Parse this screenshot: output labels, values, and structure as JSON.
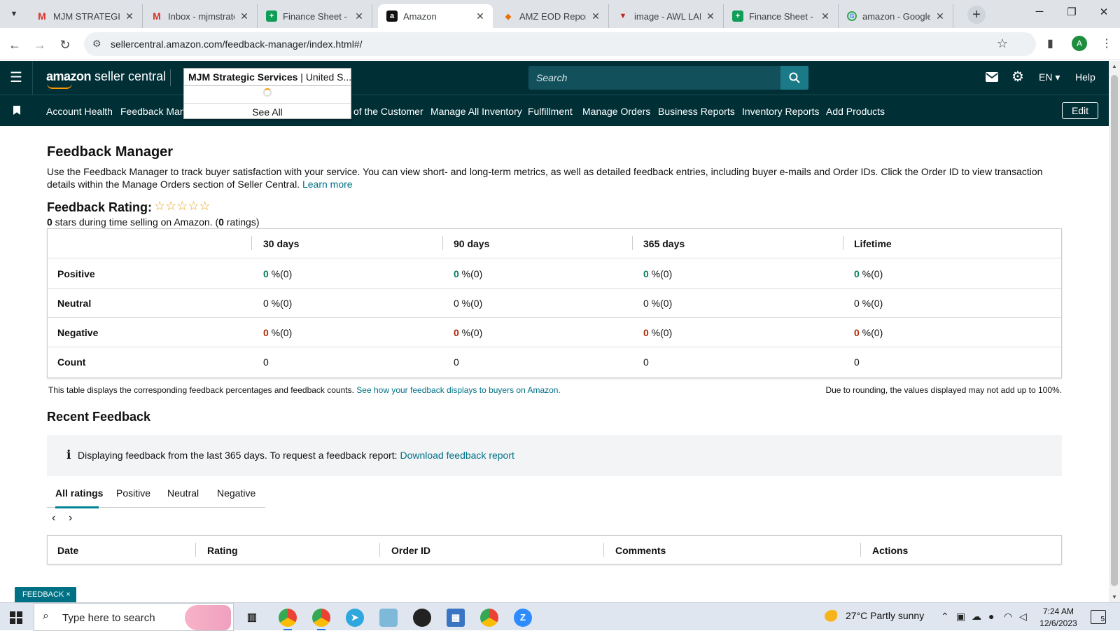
{
  "browser": {
    "tabs": [
      {
        "title": "MJM STRATEGIC S",
        "icon": "gmail-icon"
      },
      {
        "title": "Inbox - mjmstrate",
        "icon": "gmail-icon"
      },
      {
        "title": "Finance Sheet - a",
        "icon": "sheets-icon"
      },
      {
        "title": "Amazon",
        "icon": "amazon-icon"
      },
      {
        "title": "AMZ EOD Report",
        "icon": "report-icon"
      },
      {
        "title": "image - AWL LABE",
        "icon": "awl-icon"
      },
      {
        "title": "Finance Sheet - a",
        "icon": "sheets-icon"
      },
      {
        "title": "amazon - Google",
        "icon": "google-icon"
      }
    ],
    "url": "sellercentral.amazon.com/feedback-manager/index.html#/",
    "profile_initial": "A"
  },
  "header": {
    "logo_amazon": "amazon",
    "logo_rest": " seller central",
    "account_name": "MJM Strategic Services",
    "account_market": " | United S...",
    "search_placeholder": "Search",
    "language": "EN",
    "help": "Help"
  },
  "account_dropdown": {
    "see_all": "See All"
  },
  "nav": {
    "items": [
      "Account Health",
      "Feedback Mana",
      "of the Customer",
      "Manage All Inventory",
      "Fulfillment",
      "Manage Orders",
      "Business Reports",
      "Inventory Reports",
      "Add Products"
    ],
    "edit": "Edit"
  },
  "page": {
    "title": "Feedback Manager",
    "intro": "Use the Feedback Manager to track buyer satisfaction with your service. You can view short- and long-term metrics, as well as detailed feedback entries, including buyer e-mails and Order IDs. Click the Order ID to view transaction details within the Manage Orders section of Seller Central.",
    "learn_more": "Learn more",
    "rating_label": "Feedback Rating:",
    "stars": "☆☆☆☆☆",
    "stars_value": "0",
    "stars_text_a": " stars during time selling on Amazon. (",
    "ratings_count": "0",
    "stars_text_b": " ratings)",
    "rating_stars_filled": 0
  },
  "feedback_table": {
    "columns": [
      "30 days",
      "90 days",
      "365 days",
      "Lifetime"
    ],
    "rows": [
      {
        "label": "Positive",
        "values": [
          "0",
          "0",
          "0",
          "0"
        ],
        "suffix": " %(0)"
      },
      {
        "label": "Neutral",
        "values": [
          "0",
          "0",
          "0",
          "0"
        ],
        "suffix": " %(0)"
      },
      {
        "label": "Negative",
        "values": [
          "0",
          "0",
          "0",
          "0"
        ],
        "suffix": " %(0)"
      },
      {
        "label": "Count",
        "values": [
          "0",
          "0",
          "0",
          "0"
        ],
        "suffix": ""
      }
    ],
    "note": "This table displays the corresponding feedback percentages and feedback counts.",
    "note_link": "See how your feedback displays to buyers on Amazon.",
    "rounding": "Due to rounding, the values displayed may not add up to 100%."
  },
  "recent": {
    "title": "Recent Feedback",
    "info": "Displaying feedback from the last 365 days. To request a feedback report:",
    "info_link": "Download feedback report",
    "tabs": [
      "All ratings",
      "Positive",
      "Neutral",
      "Negative"
    ],
    "pager_prev": "‹",
    "pager_next": "›",
    "columns": [
      "Date",
      "Rating",
      "Order ID",
      "Comments",
      "Actions"
    ]
  },
  "feedback_button": "FEEDBACK ×",
  "taskbar": {
    "search_placeholder": "Type here to search",
    "weather": "27°C  Partly sunny",
    "time": "7:24 AM",
    "date": "12/6/2023",
    "notifications": "5"
  },
  "colors": {
    "header_bg": "#002f36",
    "link": "#007185",
    "positive": "#067d62",
    "negative": "#b12704",
    "star": "#e7a31b"
  }
}
